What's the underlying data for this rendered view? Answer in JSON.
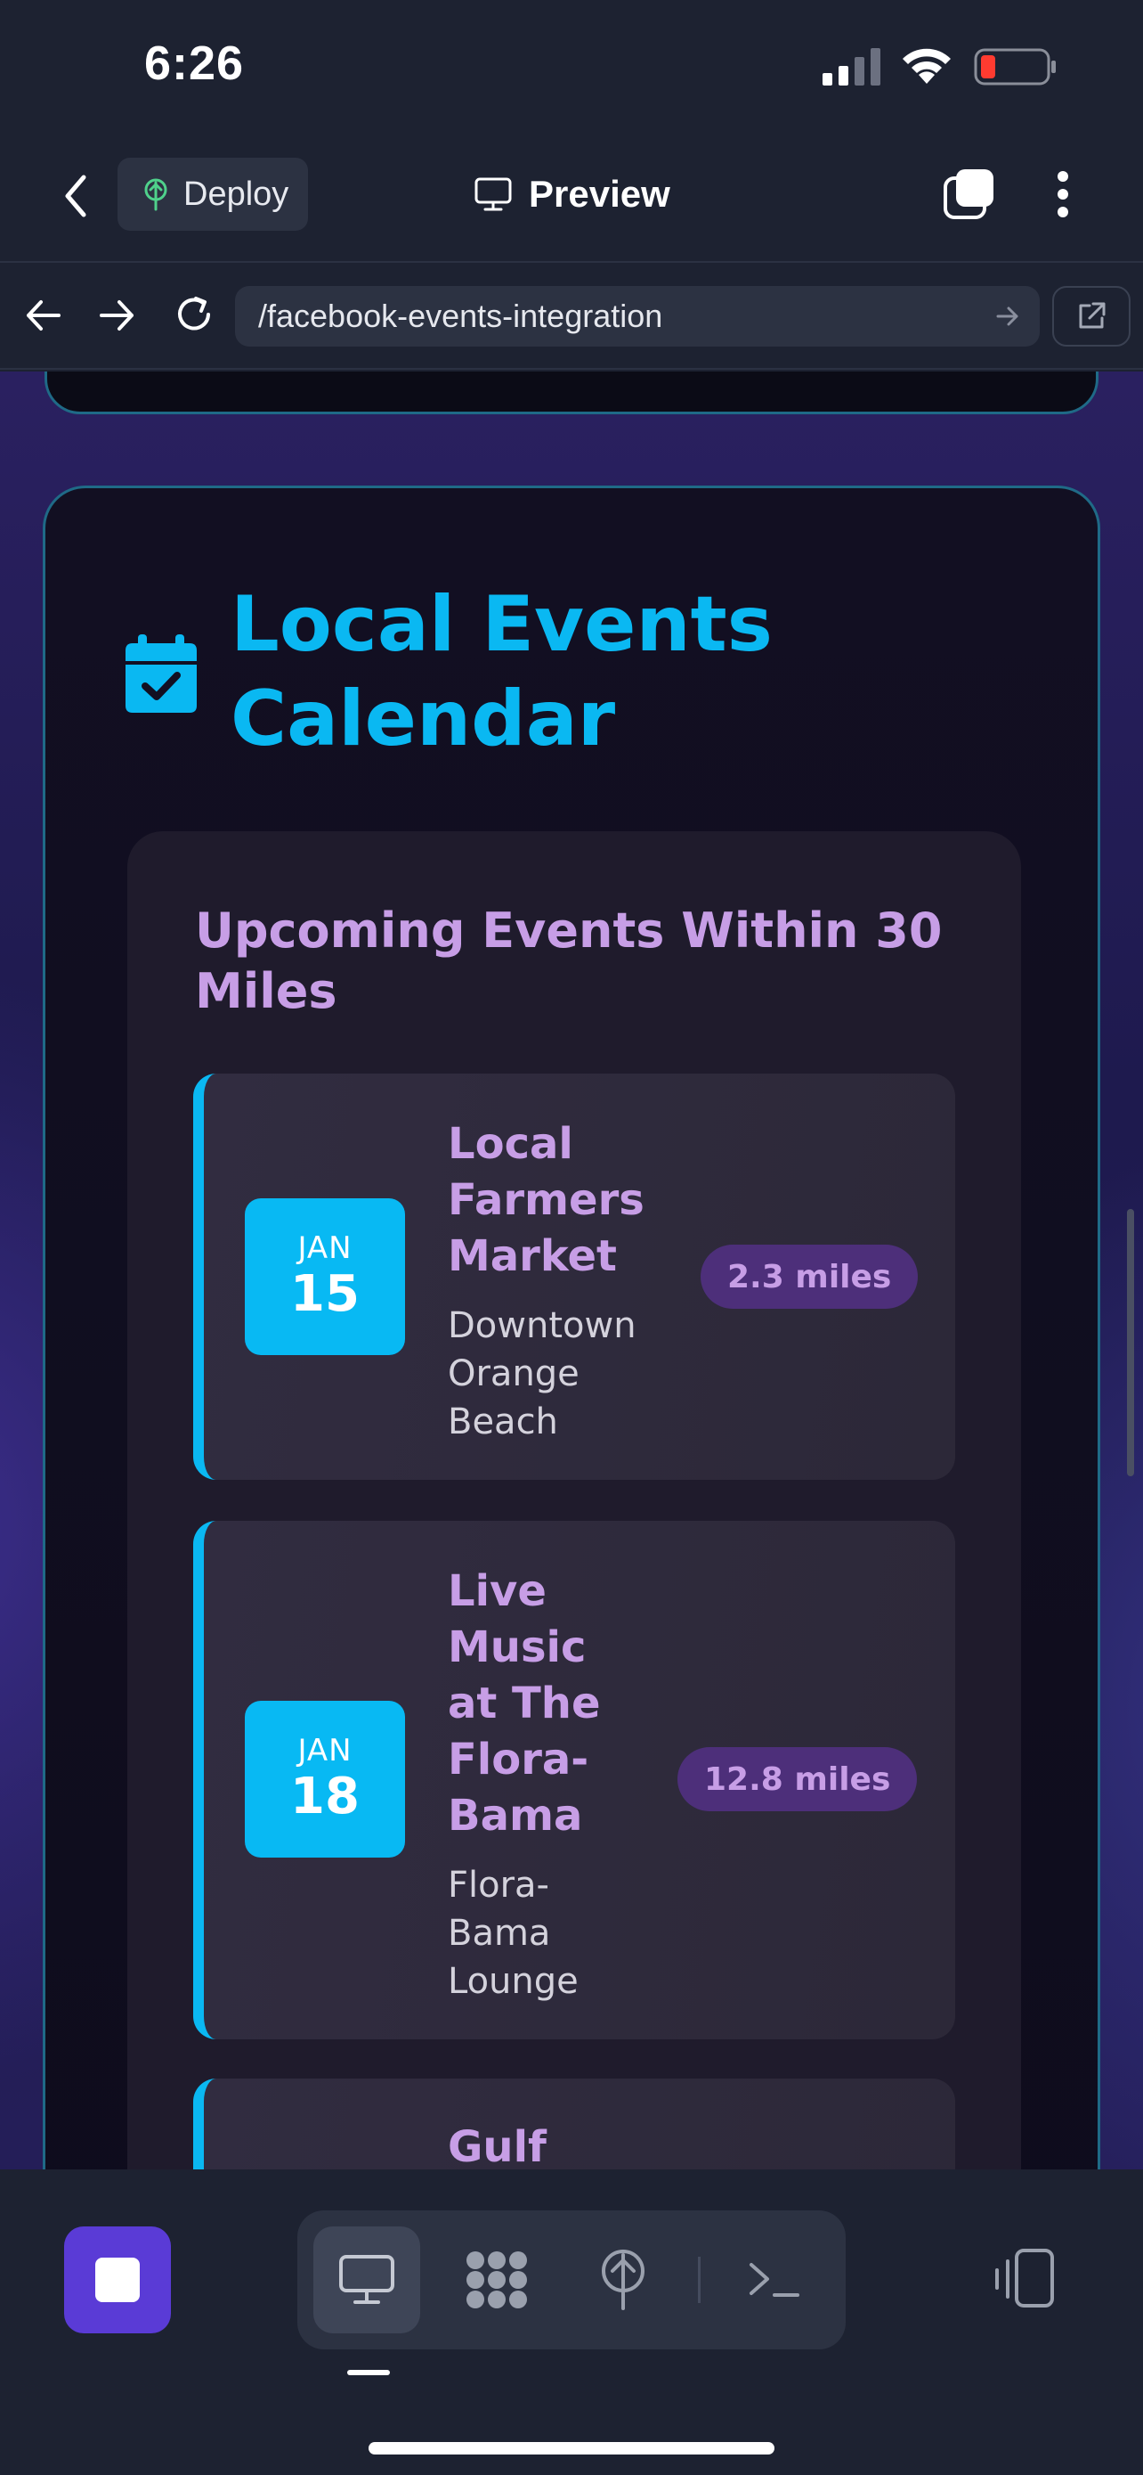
{
  "status_bar": {
    "time": "6:26"
  },
  "header": {
    "deploy_label": "Deploy",
    "preview_label": "Preview"
  },
  "browser": {
    "url": "/facebook-events-integration"
  },
  "page": {
    "section_title": "Local Events Calendar",
    "list_title": "Upcoming Events Within 30 Miles",
    "events": [
      {
        "month": "JAN",
        "day": "15",
        "name": "Local Farmers Market",
        "venue": "Downtown Orange Beach",
        "distance": "2.3 miles"
      },
      {
        "month": "JAN",
        "day": "18",
        "name": "Live Music at The Flora-Bama",
        "venue": "Flora-Bama Lounge",
        "distance": "12.8 miles"
      },
      {
        "name": "Gulf"
      }
    ]
  },
  "toolbar": {
    "tools": [
      "preview-tool",
      "workflow-tool",
      "deploy-tool",
      "terminal-tool"
    ]
  },
  "colors": {
    "accent_cyan": "#0ab8f2",
    "accent_purple": "#c79ee6",
    "stop_button": "#5a3bd6",
    "badge_bg": "#4d2f7a"
  }
}
